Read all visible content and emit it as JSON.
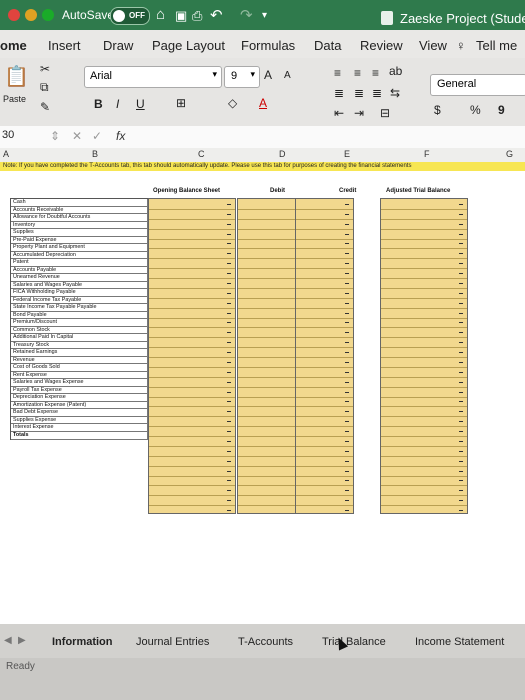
{
  "titlebar": {
    "autosave_label": "AutoSave",
    "autosave_state": "OFF",
    "document_title": "Zaeske Project (Student"
  },
  "ribbon_tabs": [
    "ome",
    "Insert",
    "Draw",
    "Page Layout",
    "Formulas",
    "Data",
    "Review",
    "View"
  ],
  "tell_me": "Tell me",
  "ribbon": {
    "paste_label": "Paste",
    "font_name": "Arial",
    "font_size": "9",
    "grow_font": "A",
    "shrink_font": "A",
    "bold": "B",
    "italic": "I",
    "underline": "U",
    "number_format": "General",
    "percent": "%",
    "comma": "9"
  },
  "formula_bar": {
    "name_box": "30",
    "cancel": "✕",
    "enter": "✓",
    "fx": "fx"
  },
  "columns": [
    "A",
    "B",
    "C",
    "D",
    "E",
    "F",
    "G"
  ],
  "sheet": {
    "note": "Note: If you have completed the T-Accounts tab, this tab should automatically update. Please use this tab for purposes of creating the financial statements",
    "headers": {
      "opening": "Opening Balance Sheet",
      "debit": "Debit",
      "credit": "Credit",
      "adjusted": "Adjusted Trial Balance"
    },
    "cell_placeholder": "-",
    "accounts": [
      "Cash",
      "Accounts Receivable",
      "Allowance for Doubtful Accounts",
      "Inventory",
      "Supplies",
      "Pre-Paid Expense",
      "Property Plant and Equipment",
      "Accumulated Depreciation",
      "Patent",
      "Accounts Payable",
      "Unearned Revenue",
      "Salaries and Wages Payable",
      "FICA Withholding Payable",
      "Federal Income Tax Payable",
      "State Income Tax Payable Payable",
      "Bond Payable",
      "Premium/Discount",
      "Common Stock",
      "Additional Paid In Capital",
      "Treasury Stock",
      "Retained Earnings",
      "Revenue",
      "Cost of Goods Sold",
      "Rent Expense",
      "Salaries and Wages Expense",
      "Payroll Tax Expense",
      "Depreciation Expense",
      "Amortization Expense (Patent)",
      "Bad Debt Expense",
      "Supplies Expense",
      "Interest Expense",
      "Totals"
    ]
  },
  "sheet_tabs": [
    "Information",
    "Journal Entries",
    "T-Accounts",
    "Trial Balance",
    "Income Statement"
  ],
  "active_sheet": "Information",
  "status": "Ready",
  "colors": {
    "title_green": "#2f7a4c",
    "note_yellow": "#f7e653",
    "cell_tan": "#f2d88e"
  }
}
